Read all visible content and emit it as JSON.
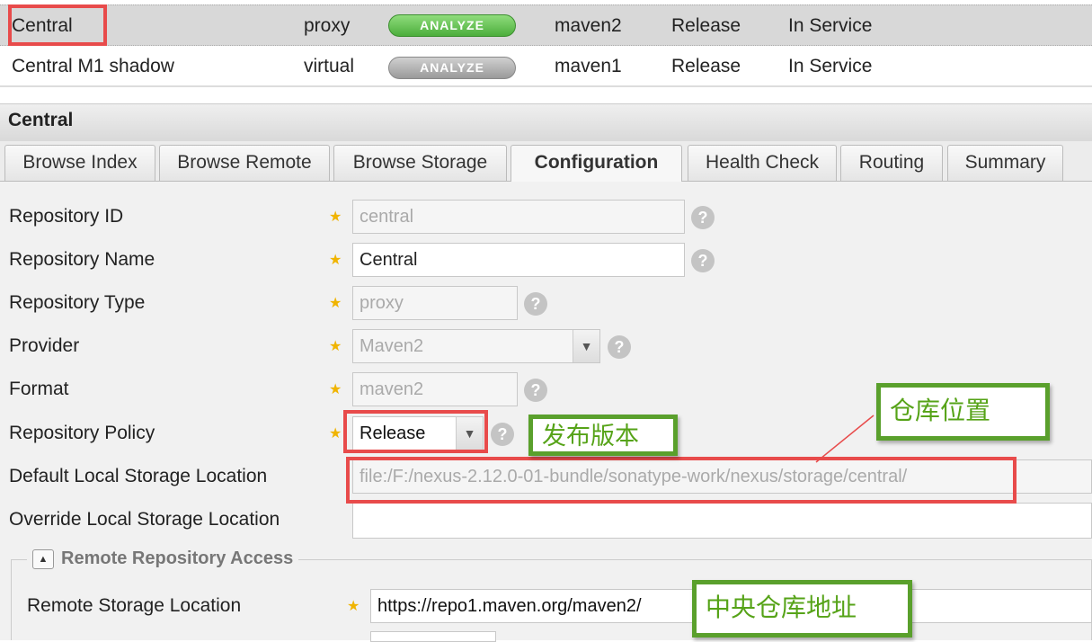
{
  "repos": [
    {
      "name": "Central",
      "type": "proxy",
      "analyze": "ANALYZE",
      "format": "maven2",
      "policy": "Release",
      "status": "In Service"
    },
    {
      "name": "Central M1 shadow",
      "type": "virtual",
      "analyze": "ANALYZE",
      "format": "maven1",
      "policy": "Release",
      "status": "In Service"
    }
  ],
  "panel": {
    "title": "Central"
  },
  "tabs": [
    "Browse Index",
    "Browse Remote",
    "Browse Storage",
    "Configuration",
    "Health Check",
    "Routing",
    "Summary"
  ],
  "form": {
    "repo_id": {
      "label": "Repository ID",
      "value": "central"
    },
    "repo_name": {
      "label": "Repository Name",
      "value": "Central"
    },
    "repo_type": {
      "label": "Repository Type",
      "value": "proxy"
    },
    "provider": {
      "label": "Provider",
      "value": "Maven2"
    },
    "format": {
      "label": "Format",
      "value": "maven2"
    },
    "policy": {
      "label": "Repository Policy",
      "value": "Release"
    },
    "default_loc": {
      "label": "Default Local Storage Location",
      "value": "file:/F:/nexus-2.12.0-01-bundle/sonatype-work/nexus/storage/central/"
    },
    "override_loc": {
      "label": "Override Local Storage Location",
      "value": ""
    },
    "remote_section": "Remote Repository Access",
    "remote_loc": {
      "label": "Remote Storage Location",
      "value": "https://repo1.maven.org/maven2/"
    }
  },
  "annotations": {
    "policy": "发布版本",
    "location": "仓库位置",
    "remote": "中央仓库地址"
  },
  "colors": {
    "analyze_active": "#5cb85c",
    "analyze_inactive": "#a8a8a8",
    "annotation_red": "#e84b4b",
    "annotation_green": "#5aa02c"
  }
}
